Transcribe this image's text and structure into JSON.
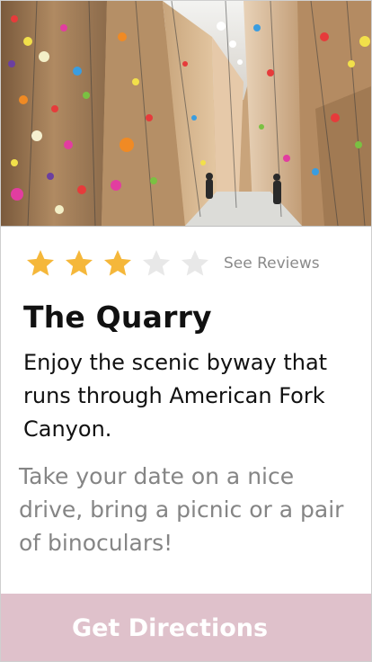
{
  "hero": {
    "image_alt": "Indoor climbing gym walls covered with colorful holds"
  },
  "rating": {
    "value": 3,
    "max": 5,
    "filled_color": "#f5b73a",
    "empty_color": "#e8e8e8",
    "reviews_label": "See Reviews"
  },
  "place": {
    "title": "The Quarry",
    "subtitle": "Enjoy the scenic byway that runs through American Fork Canyon.",
    "description": "Take your date on a nice drive, bring a picnic or a pair of binoculars!"
  },
  "cta": {
    "label": "Get Directions",
    "background": "#dfc1cb"
  }
}
